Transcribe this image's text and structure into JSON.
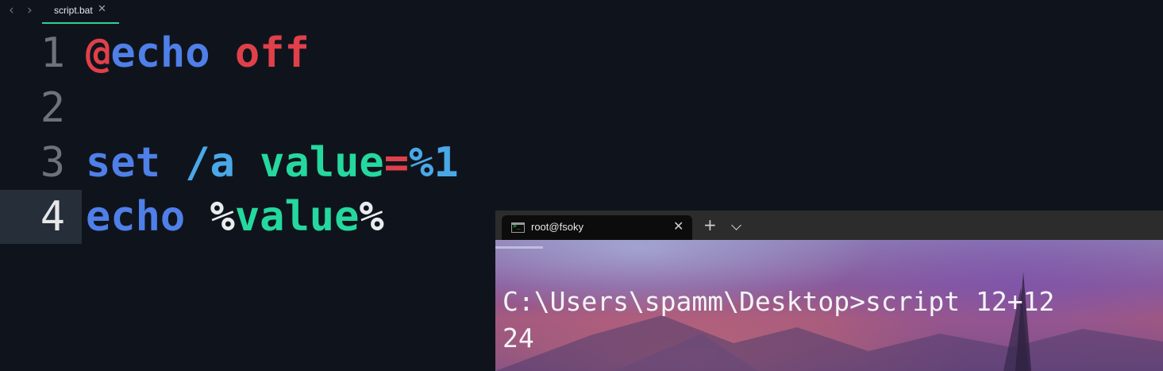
{
  "editor": {
    "nav": {
      "back_icon": "chevron-left-icon",
      "forward_icon": "chevron-right-icon"
    },
    "tab": {
      "filename": "script.bat",
      "close_icon": "close-icon",
      "accent": "#2fcf9a"
    },
    "lines": [
      {
        "number": "1",
        "tokens": [
          "@",
          "echo",
          " ",
          "off"
        ]
      },
      {
        "number": "2",
        "tokens": []
      },
      {
        "number": "3",
        "tokens": [
          "set",
          " ",
          "/a",
          " ",
          "value",
          "=",
          "%1"
        ]
      },
      {
        "number": "4",
        "tokens": [
          "echo",
          " ",
          "%",
          "value",
          "%"
        ],
        "current": true
      }
    ],
    "colors": {
      "keyword": "#4f7fe8",
      "operator": "#e0404a",
      "variable": "#25d89e",
      "switch": "#4aa8e8",
      "background": "#0f141c"
    }
  },
  "terminal": {
    "tab": {
      "title": "root@fsoky",
      "icon": "terminal-icon",
      "close_icon": "close-icon"
    },
    "new_tab_icon": "plus-icon",
    "dropdown_icon": "chevron-down-icon",
    "output": {
      "line1": "C:\\Users\\spamm\\Desktop>script 12+12",
      "line2": "24"
    }
  }
}
